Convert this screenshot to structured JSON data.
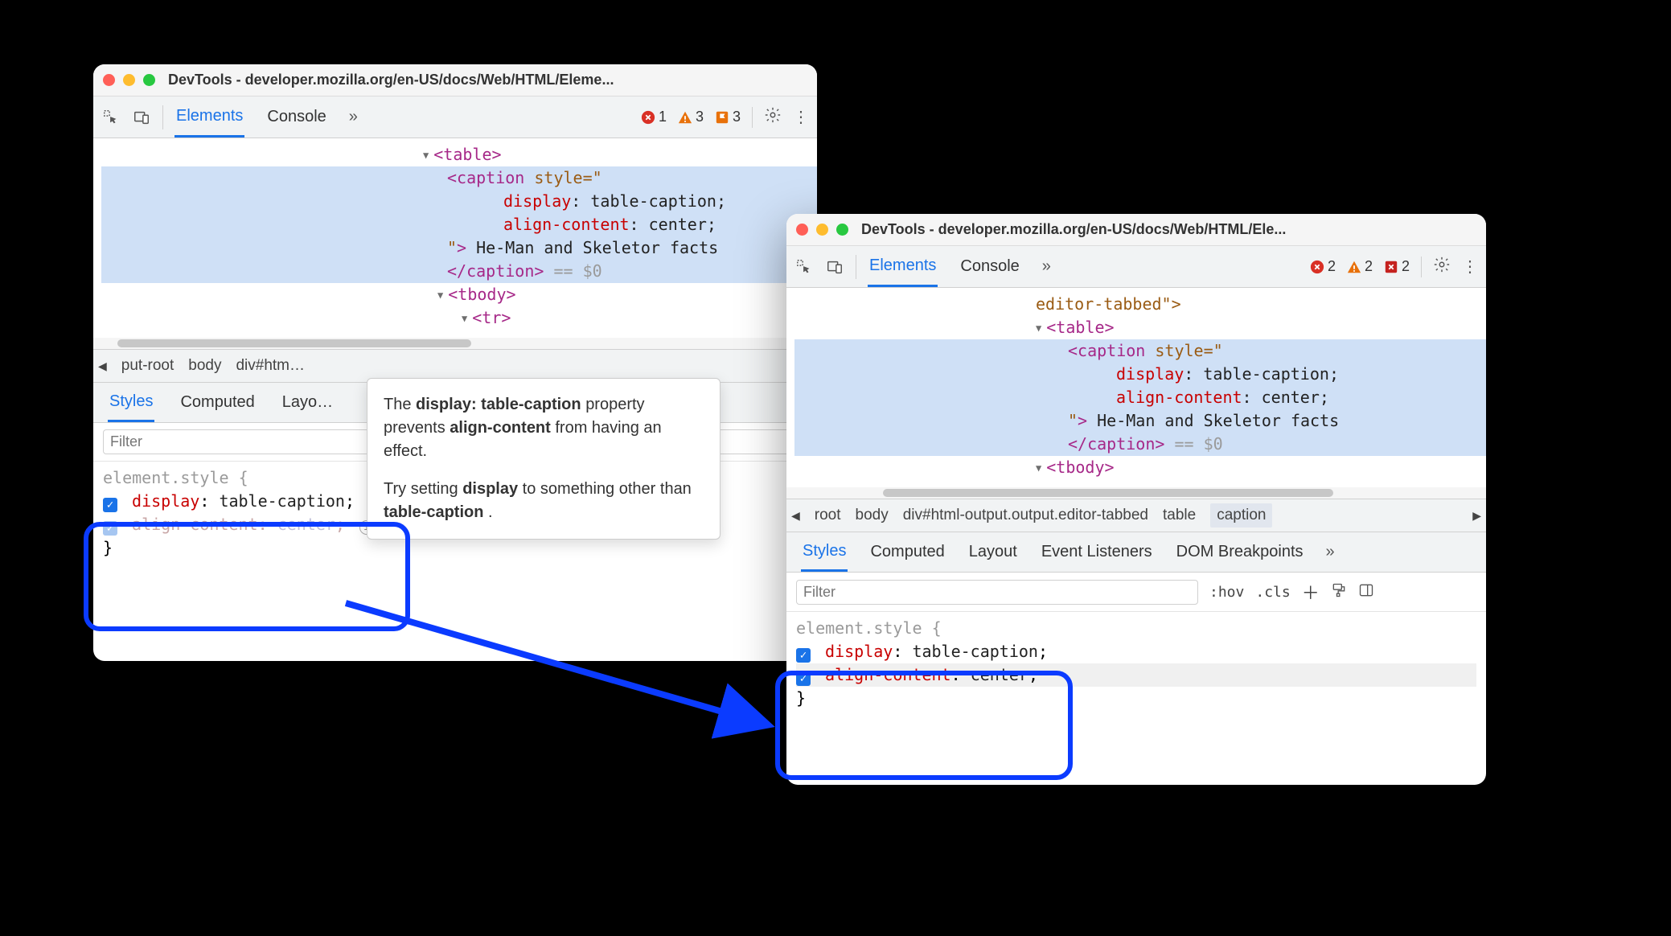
{
  "traffic_colors": {
    "close": "#ff5f57",
    "minimize": "#febc2e",
    "zoom": "#28c840"
  },
  "left": {
    "title": "DevTools - developer.mozilla.org/en-US/docs/Web/HTML/Eleme...",
    "tabs": {
      "elements": "Elements",
      "console": "Console"
    },
    "indicators": {
      "errors": "1",
      "warnings": "3",
      "flags": "3"
    },
    "dom": {
      "table_open": "<table>",
      "caption_open1": "<caption",
      "caption_style_attr": "style=\"",
      "display_prop": "display",
      "display_val": "table-caption",
      "align_prop": "align-content",
      "align_val": "center",
      "closequote": "\"",
      "gt": ">",
      "caption_text": "He-Man and Skeletor facts",
      "caption_close": "</caption>",
      "eq0": "== $0",
      "tbody_open": "<tbody>",
      "tr_open": "<tr>"
    },
    "crumbs": {
      "c0": "put-root",
      "c1": "body",
      "c2": "div#htm…"
    },
    "subtabs": {
      "styles": "Styles",
      "computed": "Computed",
      "layout": "Layo…"
    },
    "filter_placeholder": "Filter",
    "style_rule": {
      "selector": "element.style {",
      "display_prop": "display",
      "display_val": "table-caption",
      "align_prop": "align-content",
      "align_val": "center",
      "close": "}"
    }
  },
  "tooltip": {
    "p1a": "The ",
    "p1b": "display: table-caption",
    "p1c": " property prevents ",
    "p1d": "align-content",
    "p1e": " from having an effect.",
    "p2a": "Try setting ",
    "p2b": "display",
    "p2c": " to something other than ",
    "p2d": "table-caption",
    "p2e": "."
  },
  "right": {
    "title": "DevTools - developer.mozilla.org/en-US/docs/Web/HTML/Ele...",
    "tabs": {
      "elements": "Elements",
      "console": "Console"
    },
    "indicators": {
      "errors": "2",
      "warnings": "2",
      "flags": "2"
    },
    "dom": {
      "line0": "editor-tabbed\">",
      "table_open": "<table>",
      "caption_open1": "<caption",
      "caption_style_attr": "style=\"",
      "display_prop": "display",
      "display_val": "table-caption",
      "align_prop": "align-content",
      "align_val": "center",
      "closequote": "\"",
      "gt": ">",
      "caption_text": "He-Man and Skeletor facts",
      "caption_close": "</caption>",
      "eq0": "== $0",
      "tbody_open": "<tbody>"
    },
    "crumbs": {
      "c0": "root",
      "c1": "body",
      "c2": "div#html-output.output.editor-tabbed",
      "c3": "table",
      "c4": "caption"
    },
    "subtabs": {
      "styles": "Styles",
      "computed": "Computed",
      "layout": "Layout",
      "events": "Event Listeners",
      "dombp": "DOM Breakpoints"
    },
    "filter_placeholder": "Filter",
    "filter_tools": {
      "hov": ":hov",
      "cls": ".cls"
    },
    "style_rule": {
      "selector": "element.style {",
      "display_prop": "display",
      "display_val": "table-caption",
      "align_prop": "align-content",
      "align_val": "center",
      "close": "}"
    }
  }
}
